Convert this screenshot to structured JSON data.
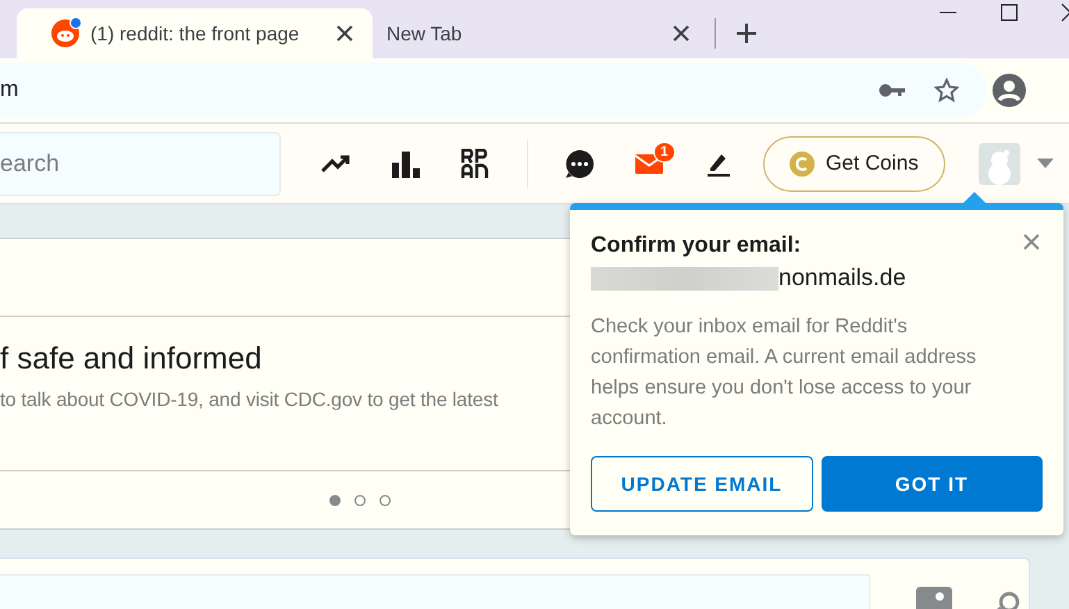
{
  "browser": {
    "tabs": [
      {
        "title": "(1) reddit: the front page",
        "selected": true,
        "notification": true
      },
      {
        "title": "New Tab",
        "selected": false
      }
    ],
    "address": "m"
  },
  "header": {
    "search": {
      "placeholder": "earch"
    },
    "notification_count": "1",
    "coins_button": "Get Coins"
  },
  "announcement": {
    "title": "f safe and informed",
    "text": "to talk about COVID-19, and visit CDC.gov to get the latest",
    "pages": [
      {
        "selected": true
      },
      {
        "selected": false
      },
      {
        "selected": false
      }
    ]
  },
  "popup": {
    "title": "Confirm your email:",
    "email": "nonmails.de",
    "text": "Check your inbox email for Reddit's confirmation email. A current email address helps ensure you don't lose access to your account.",
    "buttons": [
      {
        "label": "UPDATE EMAIL",
        "kind": "outline"
      },
      {
        "label": "GOT IT",
        "kind": "primary"
      }
    ]
  }
}
